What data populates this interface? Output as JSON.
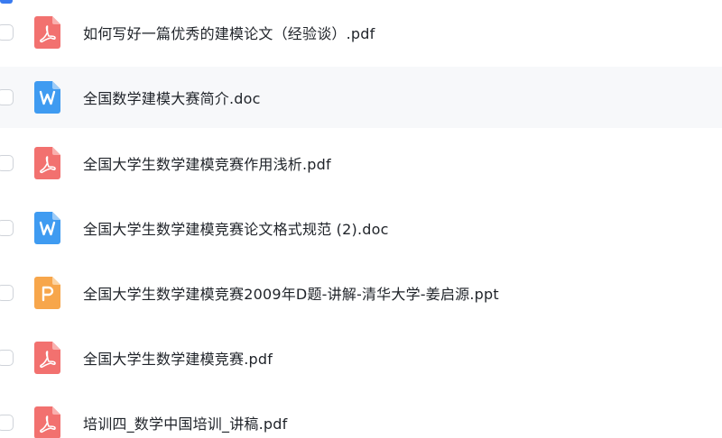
{
  "colors": {
    "pdf": "#f2716f",
    "doc": "#3f9bf1",
    "ppt": "#f7a64b",
    "row_hover": "#f7f8fa",
    "check_selected": "#3a7bf0"
  },
  "files": [
    {
      "name": "如何写好一篇优秀的建模论文（经验谈）.pdf",
      "type": "pdf",
      "icon": "pdf-file-icon"
    },
    {
      "name": "全国数学建模大赛简介.doc",
      "type": "doc",
      "icon": "word-file-icon"
    },
    {
      "name": "全国大学生数学建模竞赛作用浅析.pdf",
      "type": "pdf",
      "icon": "pdf-file-icon"
    },
    {
      "name": "全国大学生数学建模竞赛论文格式规范 (2).doc",
      "type": "doc",
      "icon": "word-file-icon"
    },
    {
      "name": "全国大学生数学建模竞赛2009年D题-讲解-清华大学-姜启源.ppt",
      "type": "ppt",
      "icon": "ppt-file-icon"
    },
    {
      "name": "全国大学生数学建模竞赛.pdf",
      "type": "pdf",
      "icon": "pdf-file-icon"
    },
    {
      "name": "培训四_数学中国培训_讲稿.pdf",
      "type": "pdf",
      "icon": "pdf-file-icon"
    }
  ]
}
